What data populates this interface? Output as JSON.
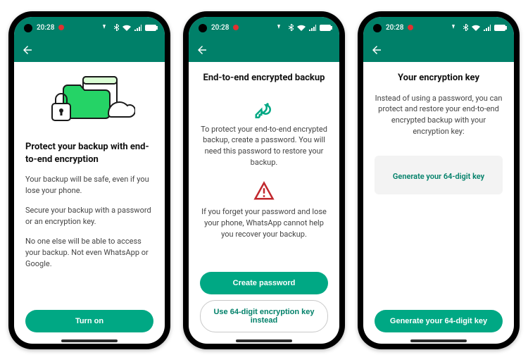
{
  "status": {
    "time": "20:28",
    "icons": [
      "vowifi-icon",
      "bluetooth-icon",
      "wifi-icon",
      "signal-icon",
      "battery-icon"
    ]
  },
  "colors": {
    "brand": "#008069",
    "accent": "#00a884",
    "warn": "#c1272d"
  },
  "screens": [
    {
      "title": "Protect your backup with end-to-end encryption",
      "paragraphs": [
        "Your backup will be safe, even if you lose your phone.",
        "Secure your backup with a password or an encryption key.",
        "No one else will be able to access your backup. Not even WhatsApp or Google."
      ],
      "primary_button": "Turn on"
    },
    {
      "title": "End-to-end encrypted backup",
      "key_paragraph": "To protect your end-to-end encrypted backup, create a password. You will need this password to restore your backup.",
      "warn_paragraph": "If you forget your password and lose your phone, WhatsApp cannot help you recover your backup.",
      "primary_button": "Create password",
      "secondary_button": "Use 64-digit encryption key instead"
    },
    {
      "title": "Your encryption key",
      "paragraph": "Instead of using a password, you can protect and restore your end-to-end encrypted backup with your encryption key:",
      "panel_link": "Generate your 64-digit key",
      "primary_button": "Generate your 64-digit key"
    }
  ]
}
